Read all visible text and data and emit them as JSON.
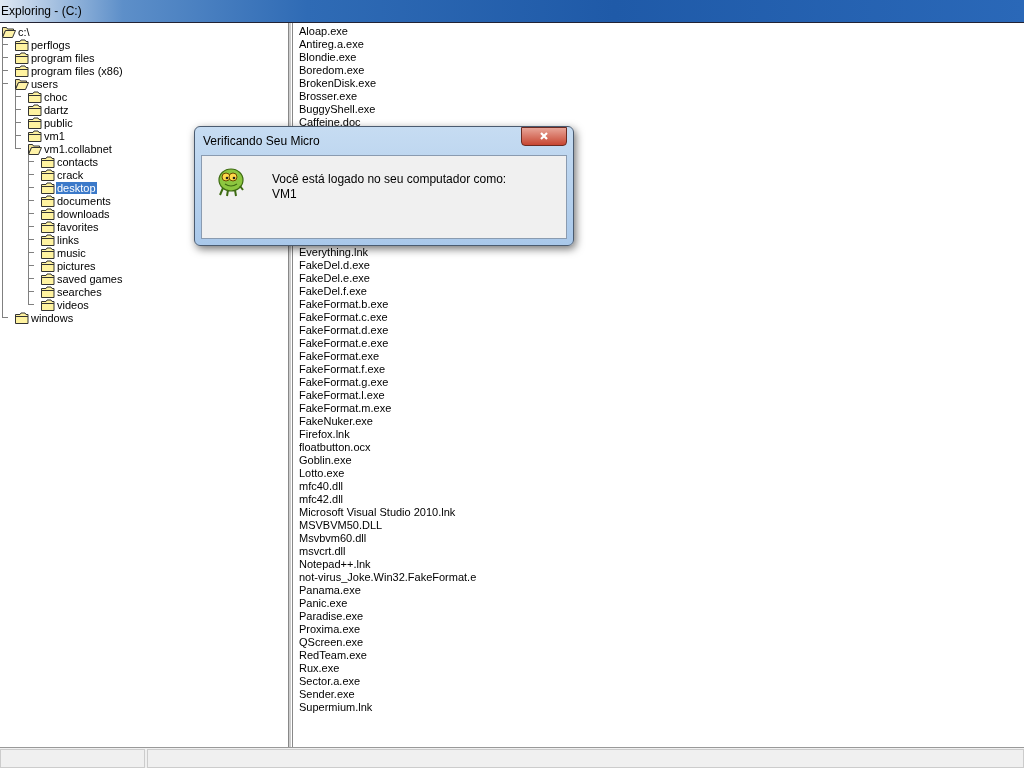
{
  "window": {
    "title": "Exploring - (C:)"
  },
  "tree": {
    "label": "c:\\",
    "expanded": true,
    "selected": false,
    "children": [
      {
        "label": "perflogs",
        "expanded": false,
        "selected": false
      },
      {
        "label": "program files",
        "expanded": false,
        "selected": false
      },
      {
        "label": "program files (x86)",
        "expanded": false,
        "selected": false
      },
      {
        "label": "users",
        "expanded": true,
        "selected": false,
        "children": [
          {
            "label": "choc",
            "expanded": false,
            "selected": false
          },
          {
            "label": "dartz",
            "expanded": false,
            "selected": false
          },
          {
            "label": "public",
            "expanded": false,
            "selected": false
          },
          {
            "label": "vm1",
            "expanded": false,
            "selected": false
          },
          {
            "label": "vm1.collabnet",
            "expanded": true,
            "selected": false,
            "children": [
              {
                "label": "contacts",
                "expanded": false,
                "selected": false
              },
              {
                "label": "crack",
                "expanded": false,
                "selected": false
              },
              {
                "label": "desktop",
                "expanded": false,
                "selected": true
              },
              {
                "label": "documents",
                "expanded": false,
                "selected": false
              },
              {
                "label": "downloads",
                "expanded": false,
                "selected": false
              },
              {
                "label": "favorites",
                "expanded": false,
                "selected": false
              },
              {
                "label": "links",
                "expanded": false,
                "selected": false
              },
              {
                "label": "music",
                "expanded": false,
                "selected": false
              },
              {
                "label": "pictures",
                "expanded": false,
                "selected": false
              },
              {
                "label": "saved games",
                "expanded": false,
                "selected": false
              },
              {
                "label": "searches",
                "expanded": false,
                "selected": false
              },
              {
                "label": "videos",
                "expanded": false,
                "selected": false
              }
            ]
          }
        ]
      },
      {
        "label": "windows",
        "expanded": false,
        "selected": false
      }
    ]
  },
  "files_top": [
    "Aloap.exe",
    "Antireg.a.exe",
    "Blondie.exe",
    "Boredom.exe",
    "BrokenDisk.exe",
    "Brosser.exe",
    "BuggyShell.exe",
    "Caffeine.doc"
  ],
  "files_bottom": [
    "Everything.lnk",
    "FakeDel.d.exe",
    "FakeDel.e.exe",
    "FakeDel.f.exe",
    "FakeFormat.b.exe",
    "FakeFormat.c.exe",
    "FakeFormat.d.exe",
    "FakeFormat.e.exe",
    "FakeFormat.exe",
    "FakeFormat.f.exe",
    "FakeFormat.g.exe",
    "FakeFormat.l.exe",
    "FakeFormat.m.exe",
    "FakeNuker.exe",
    "Firefox.lnk",
    "floatbutton.ocx",
    "Goblin.exe",
    "Lotto.exe",
    "mfc40.dll",
    "mfc42.dll",
    "Microsoft Visual Studio 2010.lnk",
    "MSVBVM50.DLL",
    "Msvbvm60.dll",
    "msvcrt.dll",
    "Notepad++.lnk",
    "not-virus_Joke.Win32.FakeFormat.e",
    "Panama.exe",
    "Panic.exe",
    "Paradise.exe",
    "Proxima.exe",
    "QScreen.exe",
    "RedTeam.exe",
    "Rux.exe",
    "Sector.a.exe",
    "Sender.exe",
    "Supermium.lnk"
  ],
  "dialog": {
    "title": "Verificando Seu Micro",
    "message": "Você está logado no seu computador como:",
    "user": "VM1"
  }
}
